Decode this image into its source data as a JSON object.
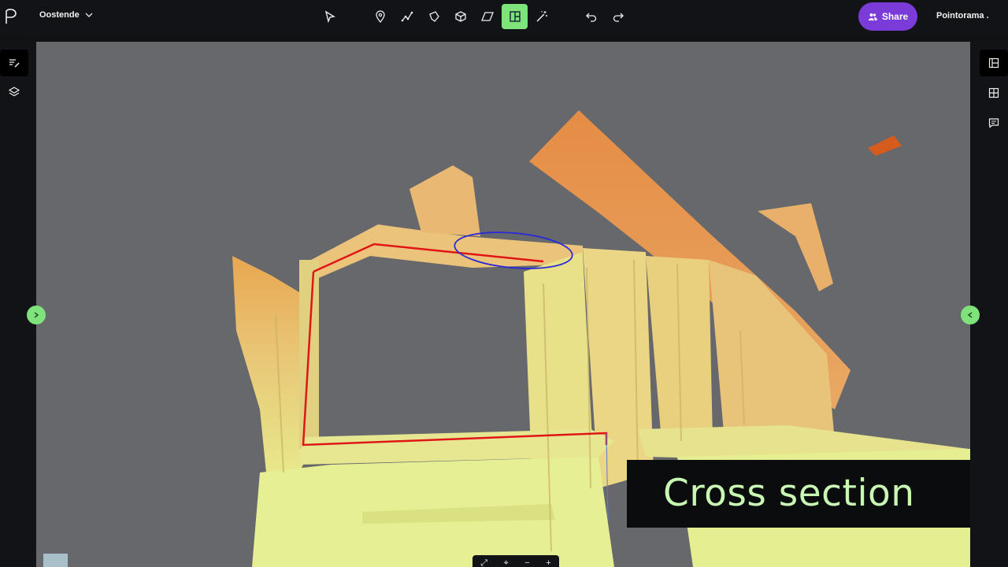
{
  "header": {
    "project_name": "Oostende",
    "share_label": "Share",
    "account_name": "Pointorama ."
  },
  "tools": [
    {
      "name": "select-tool",
      "icon": "cursor-icon"
    },
    {
      "name": "point-tool",
      "icon": "location-pin-icon"
    },
    {
      "name": "polyline-tool",
      "icon": "polyline-icon"
    },
    {
      "name": "polygon-tool",
      "icon": "polygon-icon"
    },
    {
      "name": "box-tool",
      "icon": "cube-icon"
    },
    {
      "name": "plane-tool",
      "icon": "parallelogram-icon"
    },
    {
      "name": "cross-section-tool",
      "icon": "cross-section-icon",
      "active": true
    },
    {
      "name": "magic-wand-tool",
      "icon": "magic-wand-icon"
    },
    {
      "name": "undo-button",
      "icon": "undo-icon"
    },
    {
      "name": "redo-button",
      "icon": "redo-icon"
    }
  ],
  "left_panel": [
    "annotations-icon",
    "layers-icon"
  ],
  "right_panel": [
    "panel-icon",
    "table-icon",
    "comment-icon"
  ],
  "caption": "Cross section",
  "bottom_toolbar": [
    "⤢",
    "⌖",
    "−",
    "+"
  ],
  "colors": {
    "accent": "#7ee37a",
    "share": "#7a3bd8",
    "background": "#66686c",
    "section_line": "#e01616",
    "selection_ellipse": "#2a2ad8"
  }
}
